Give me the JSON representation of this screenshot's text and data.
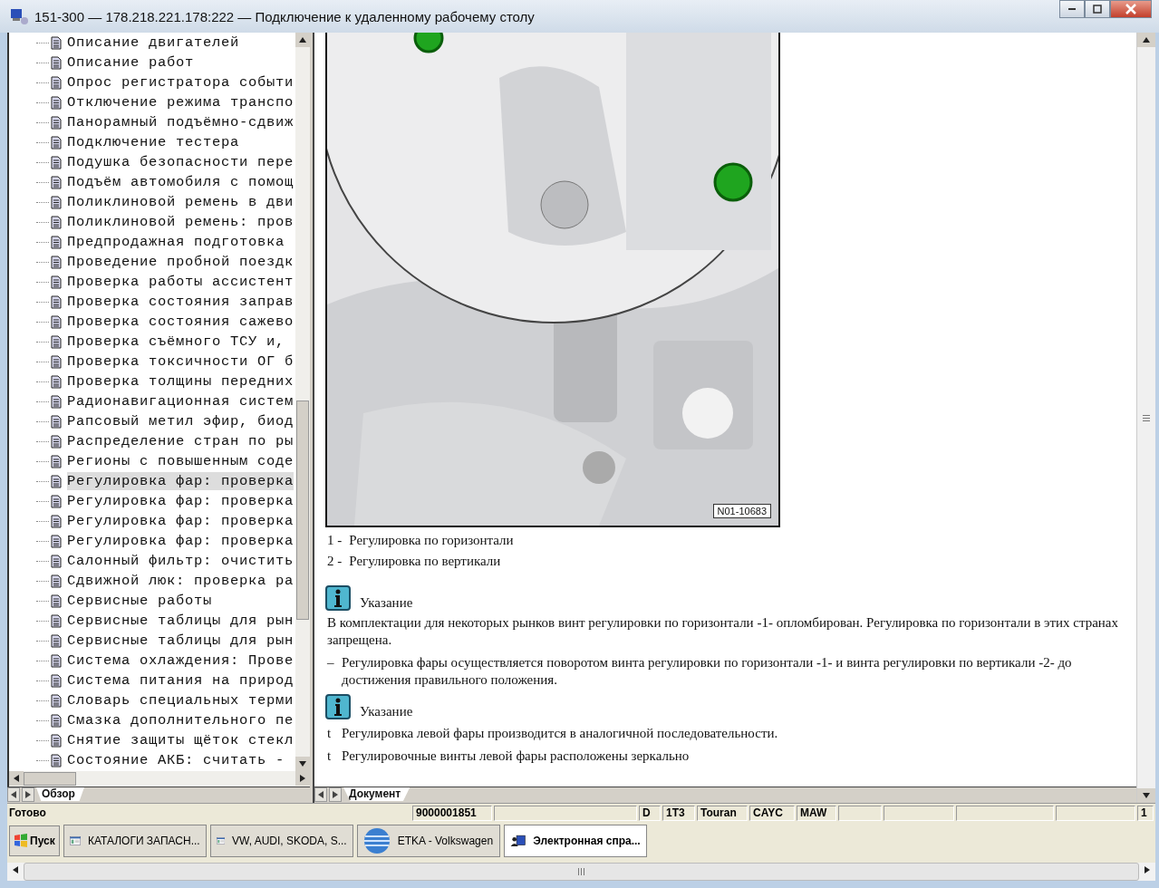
{
  "window": {
    "title": "151-300 — 178.218.221.178:222 — Подключение к удаленному рабочему столу"
  },
  "tree": {
    "items": [
      {
        "label": "Описание двигателей",
        "selected": false
      },
      {
        "label": "Описание работ",
        "selected": false
      },
      {
        "label": "Опрос регистратора событи",
        "selected": false
      },
      {
        "label": "Отключение режима транспо",
        "selected": false
      },
      {
        "label": "Панорамный подъёмно-сдвиж",
        "selected": false
      },
      {
        "label": "Подключение тестера",
        "selected": false
      },
      {
        "label": "Подушка безопасности пере",
        "selected": false
      },
      {
        "label": "Подъём автомобиля с помощ",
        "selected": false
      },
      {
        "label": "Поликлиновой ремень в дви",
        "selected": false
      },
      {
        "label": "Поликлиновой ремень: пров",
        "selected": false
      },
      {
        "label": "Предпродажная подготовка",
        "selected": false
      },
      {
        "label": "Проведение пробной поездк",
        "selected": false
      },
      {
        "label": "Проверка работы ассистент",
        "selected": false
      },
      {
        "label": "Проверка состояния заправ",
        "selected": false
      },
      {
        "label": "Проверка состояния сажево",
        "selected": false
      },
      {
        "label": "Проверка съёмного ТСУ и,",
        "selected": false
      },
      {
        "label": "Проверка токсичности ОГ б",
        "selected": false
      },
      {
        "label": "Проверка толщины передних",
        "selected": false
      },
      {
        "label": "Радионавигационная систем",
        "selected": false
      },
      {
        "label": "Рапсовый метил эфир, биод",
        "selected": false
      },
      {
        "label": "Распределение стран по ры",
        "selected": false
      },
      {
        "label": "Регионы с повышенным соде",
        "selected": false
      },
      {
        "label": "Регулировка фар: проверка",
        "selected": true
      },
      {
        "label": "Регулировка фар: проверка",
        "selected": false
      },
      {
        "label": "Регулировка фар: проверка",
        "selected": false
      },
      {
        "label": "Регулировка фар: проверка",
        "selected": false
      },
      {
        "label": "Салонный фильтр: очистить",
        "selected": false
      },
      {
        "label": "Сдвижной люк: проверка ра",
        "selected": false
      },
      {
        "label": "Сервисные работы",
        "selected": false
      },
      {
        "label": "Сервисные таблицы для рын",
        "selected": false
      },
      {
        "label": "Сервисные таблицы для рын",
        "selected": false
      },
      {
        "label": "Система охлаждения: Прове",
        "selected": false
      },
      {
        "label": "Система питания на природ",
        "selected": false
      },
      {
        "label": "Словарь специальных терми",
        "selected": false
      },
      {
        "label": "Смазка дополнительного пе",
        "selected": false
      },
      {
        "label": "Снятие защиты щёток стекл",
        "selected": false
      },
      {
        "label": "Состояние АКБ: считать -",
        "selected": false
      }
    ]
  },
  "left_tabs": [
    {
      "label": "Обзор",
      "selected": true
    }
  ],
  "document": {
    "figure": {
      "kind": "picture",
      "label": "N01-10683"
    },
    "legend": [
      {
        "number": "1 -",
        "text": "Регулировка по горизонтали"
      },
      {
        "number": "2 -",
        "text": "Регулировка по вертикали"
      }
    ],
    "blocks": [
      {
        "kind": "note",
        "title": "Указание"
      },
      {
        "kind": "para",
        "text": "В комплектации для некоторых рынков винт регулировки по горизонтали -1- опломбирован. Регулировка по горизонтали в этих странах запрещена."
      },
      {
        "kind": "bullet",
        "marker": "–",
        "text": "Регулировка фары осуществляется поворотом винта регулировки по горизонтали -1- и винта регулировки по вертикали -2- до достижения правильного положения."
      },
      {
        "kind": "note",
        "title": "Указание"
      },
      {
        "kind": "bullet",
        "marker": "t",
        "text": "Регулировка левой фары производится в аналогичной последовательности."
      },
      {
        "kind": "bullet",
        "marker": "t",
        "text": "Регулировочные винты левой фары расположены зеркально"
      }
    ]
  },
  "right_tabs": [
    {
      "label": "Документ",
      "selected": true
    }
  ],
  "status_bar": {
    "status": "Готово",
    "cells": [
      "9000001851",
      "",
      "D",
      "1T3",
      "Touran",
      "CAYC",
      "MAW",
      "",
      "",
      "",
      "",
      "1"
    ]
  },
  "taskbar": {
    "start": "Пуск",
    "items": [
      {
        "label": "КАТАЛОГИ ЗАПАСН...",
        "kind": "window",
        "selected": false
      },
      {
        "label": "VW, AUDI, SKODA, S...",
        "kind": "window",
        "selected": false
      },
      {
        "label": "ETKA - Volkswagen",
        "kind": "globe",
        "selected": false
      },
      {
        "label": "Электронная спра...",
        "kind": "help",
        "selected": true
      }
    ]
  }
}
